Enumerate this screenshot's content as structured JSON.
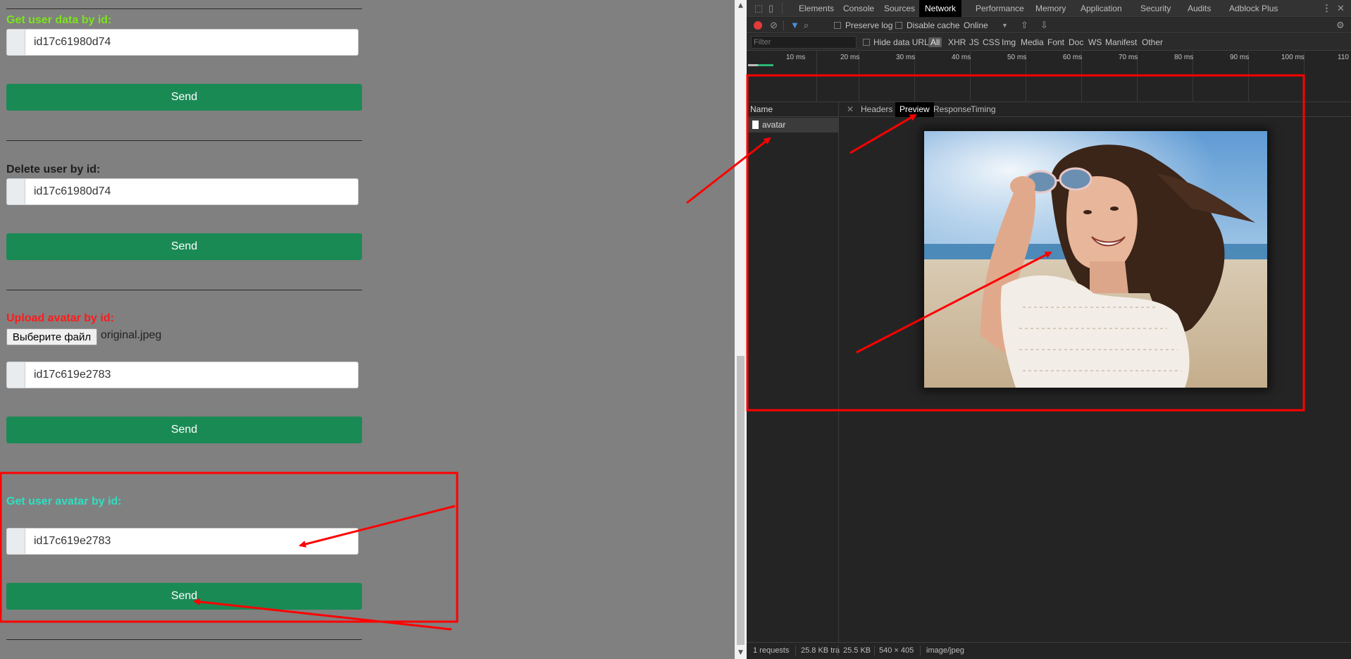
{
  "page": {
    "sections": [
      {
        "title": "Get user data by id:",
        "color": "#7be51b",
        "input": "id17c61980d74",
        "button": "Send"
      },
      {
        "title": "Delete user by id:",
        "color": "#1e1e1e",
        "input": "id17c61980d74",
        "button": "Send"
      },
      {
        "title": "Upload avatar by id:",
        "color": "#ff1a1a",
        "file_button": "Выберите файл",
        "file_name": "original.jpeg",
        "input": "id17c619e2783",
        "button": "Send"
      },
      {
        "title": "Get user avatar by id:",
        "color": "#2de0c2",
        "input": "id17c619e2783",
        "button": "Send"
      }
    ]
  },
  "devtools": {
    "tabs": [
      "Elements",
      "Console",
      "Sources",
      "Network",
      "Performance",
      "Memory",
      "Application",
      "Security",
      "Audits",
      "Adblock Plus"
    ],
    "active_tab": "Network",
    "toolbar": {
      "preserve_log": "Preserve log",
      "disable_cache": "Disable cache",
      "throttle": "Online"
    },
    "filter": {
      "placeholder": "Filter",
      "hide_data_urls": "Hide data URLs",
      "types": [
        "All",
        "XHR",
        "JS",
        "CSS",
        "Img",
        "Media",
        "Font",
        "Doc",
        "WS",
        "Manifest",
        "Other"
      ],
      "active_type": "All"
    },
    "timeline_ticks": [
      "10 ms",
      "20 ms",
      "30 ms",
      "40 ms",
      "50 ms",
      "60 ms",
      "70 ms",
      "80 ms",
      "90 ms",
      "100 ms",
      "110"
    ],
    "name_header": "Name",
    "request_name": "avatar",
    "detail_tabs": [
      "Headers",
      "Preview",
      "Response",
      "Timing"
    ],
    "active_detail_tab": "Preview",
    "status": {
      "requests": "1 requests",
      "transferred": "25.8 KB tra",
      "resources": "25.5 KB",
      "dimensions": "540 × 405",
      "mime": "image/jpeg"
    }
  },
  "colors": {
    "send_button": "#1a8a55",
    "annotation": "#ff0000",
    "devtools_bg": "#242424"
  }
}
